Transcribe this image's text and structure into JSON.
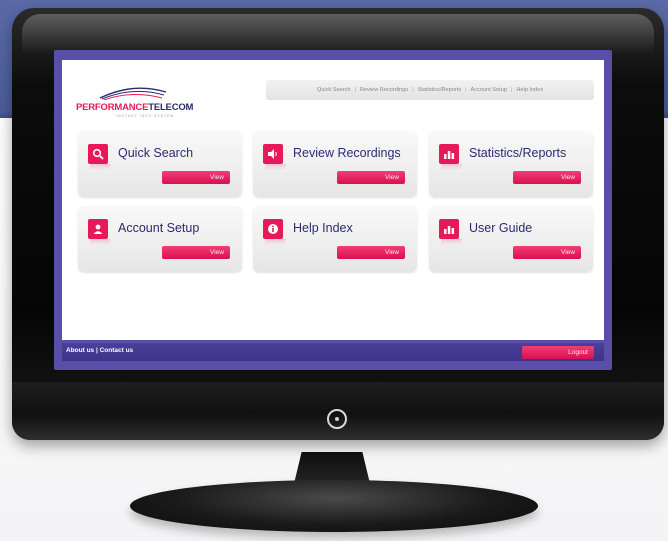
{
  "brand": {
    "name_part1": "PERFORMANCE",
    "name_part2": "TELECOM",
    "tagline": "INSTANT INFO SYSTEM"
  },
  "topnav": {
    "items": [
      "Quick Search",
      "Review Recordings",
      "Statistics/Reports",
      "Account Setup",
      "Help Index"
    ],
    "separator": "|"
  },
  "tiles": [
    {
      "title": "Quick Search",
      "button": "View",
      "icon": "search-icon"
    },
    {
      "title": "Review Recordings",
      "button": "View",
      "icon": "speaker-icon"
    },
    {
      "title": "Statistics/Reports",
      "button": "View",
      "icon": "bar-chart-icon"
    },
    {
      "title": "Account Setup",
      "button": "View",
      "icon": "user-icon"
    },
    {
      "title": "Help Index",
      "button": "View",
      "icon": "info-icon"
    },
    {
      "title": "User Guide",
      "button": "View",
      "icon": "bar-chart-icon"
    }
  ],
  "footer": {
    "links": "About us | Contact us",
    "logout": "Logout"
  },
  "colors": {
    "accent": "#e8195a",
    "navy": "#2b2b6e",
    "frame_purple": "#5a4fa8",
    "background_band": "#5a6aa6"
  }
}
